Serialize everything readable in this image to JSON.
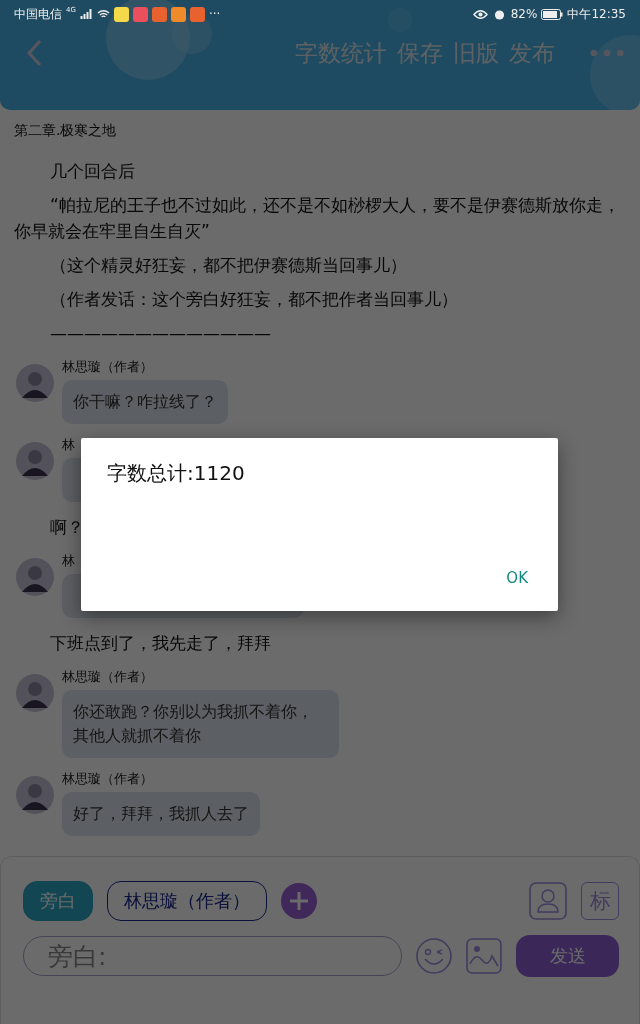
{
  "status_bar": {
    "carrier": "中国电信",
    "network": "4G",
    "more": "···",
    "battery": "82%",
    "time": "中午12:35"
  },
  "toolbar": {
    "actions": [
      "字数统计",
      "保存",
      "旧版",
      "发布"
    ]
  },
  "chapter_title": "第二章.极寒之地",
  "story": [
    {
      "kind": "narration",
      "text": "几个回合后"
    },
    {
      "kind": "narration",
      "text": "“帕拉尼的王子也不过如此，还不是不如桫椤大人，要不是伊赛德斯放你走，你早就会在牢里自生自灭”"
    },
    {
      "kind": "narration",
      "text": "（这个精灵好狂妄，都不把伊赛德斯当回事儿）"
    },
    {
      "kind": "narration",
      "text": "（作者发话：这个旁白好狂妄，都不把作者当回事儿）"
    },
    {
      "kind": "narration",
      "text": "—————————————"
    },
    {
      "kind": "message",
      "speaker": "林思璇（作者）",
      "text": "你干嘛？咋拉线了？"
    },
    {
      "kind": "message",
      "speaker": "林"
    },
    {
      "kind": "narration",
      "text": "啊？"
    },
    {
      "kind": "message",
      "speaker": "林"
    },
    {
      "kind": "narration",
      "text": "下班点到了，我先走了，拜拜"
    },
    {
      "kind": "message",
      "speaker": "林思璇（作者）",
      "text": "你还敢跑？你别以为我抓不着你，其他人就抓不着你"
    },
    {
      "kind": "message",
      "speaker": "林思璇（作者）",
      "text": "好了，拜拜，我抓人去了"
    }
  ],
  "dialog": {
    "title": "字数总计:1120",
    "button": "OK"
  },
  "composer": {
    "roles": [
      {
        "label": "旁白",
        "selected": true
      },
      {
        "label": "林思璇（作者）",
        "selected": false
      }
    ],
    "mark_button": "标",
    "input": {
      "placeholder": "旁白:"
    },
    "send": "发送"
  }
}
